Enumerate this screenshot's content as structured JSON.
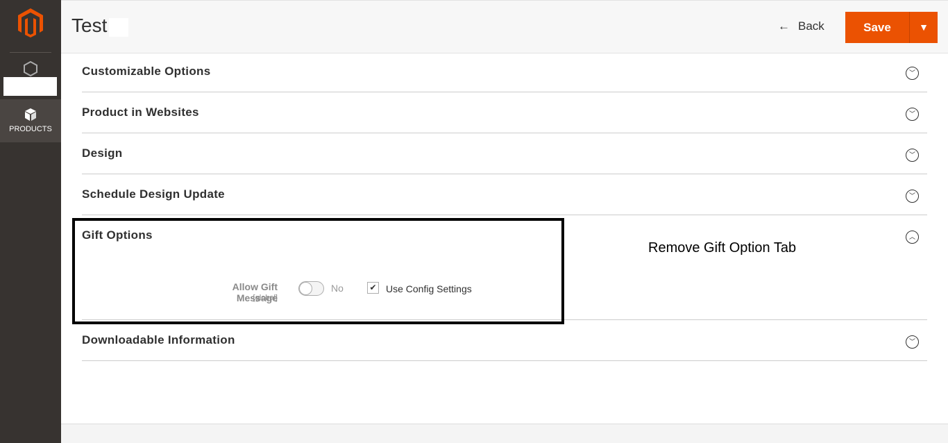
{
  "sidebar": {
    "logo": "magento-logo-icon",
    "items": [
      {
        "icon": "hexagon-icon",
        "label": ""
      },
      {
        "icon": "box-icon",
        "label": "PRODUCTS"
      }
    ]
  },
  "header": {
    "title": "Test",
    "back_label": "Back",
    "save_label": "Save"
  },
  "sections": [
    {
      "title": "Customizable Options",
      "expanded": false
    },
    {
      "title": "Product in Websites",
      "expanded": false
    },
    {
      "title": "Design",
      "expanded": false
    },
    {
      "title": "Schedule Design Update",
      "expanded": false
    },
    {
      "title": "Gift Options",
      "expanded": true
    },
    {
      "title": "Downloadable Information",
      "expanded": false
    }
  ],
  "gift_options": {
    "field_label": "Allow Gift Message",
    "scope": "[global]",
    "toggle_value": "No",
    "use_config_label": "Use Config Settings",
    "use_config_checked": true
  },
  "annotation": "Remove Gift Option Tab",
  "colors": {
    "accent": "#eb5202",
    "sidebar": "#373330"
  }
}
